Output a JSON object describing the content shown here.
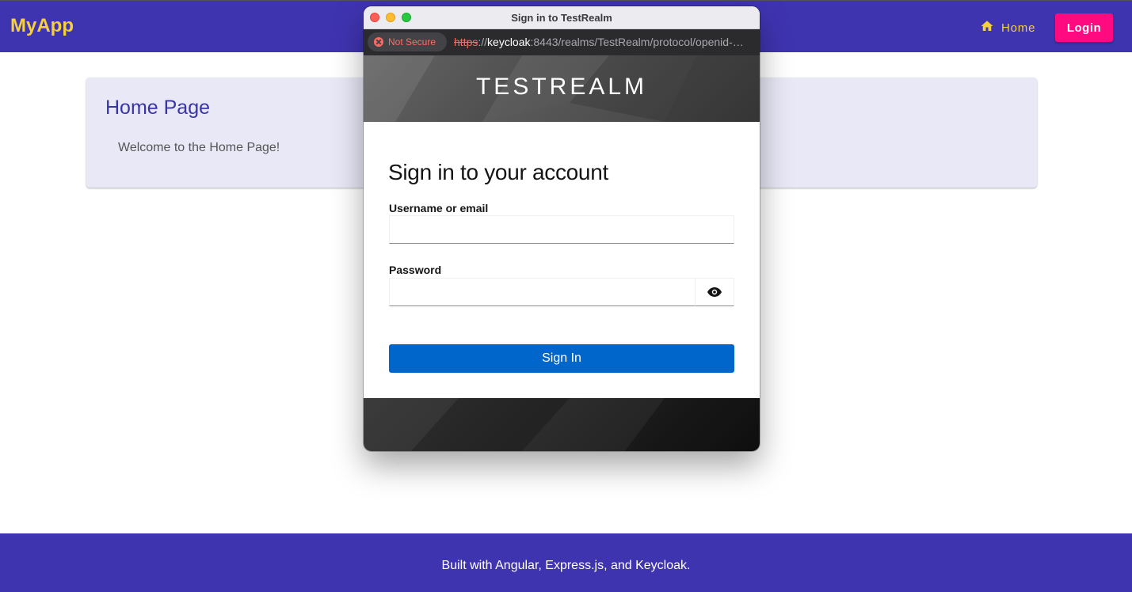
{
  "app": {
    "logo": "MyApp",
    "nav_home_label": "Home",
    "login_label": "Login"
  },
  "home": {
    "title": "Home Page",
    "welcome": "Welcome to the Home Page!"
  },
  "footer": {
    "text": "Built with Angular, Express.js, and Keycloak."
  },
  "popup": {
    "window_title": "Sign in to TestRealm",
    "security_label": "Not Secure",
    "url_scheme": "https",
    "url_separator": "://",
    "url_host": "keycloak",
    "url_rest": ":8443/realms/TestRealm/protocol/openid-connect/auth",
    "realm_name": "TESTREALM",
    "heading": "Sign in to your account",
    "username_label": "Username or email",
    "username_value": "",
    "password_label": "Password",
    "password_value": "",
    "signin_label": "Sign In"
  },
  "icons": {
    "home": "home-icon",
    "warning": "warning-circle-icon",
    "show_password": "eye-icon"
  },
  "colors": {
    "header_bg": "#3f34b0",
    "logo": "#f4d03f",
    "login_btn": "#ff0a80",
    "card_bg": "#e8e8f6",
    "title": "#3a35a6",
    "signin_btn": "#0066cc",
    "not_secure": "#ff6b63"
  }
}
